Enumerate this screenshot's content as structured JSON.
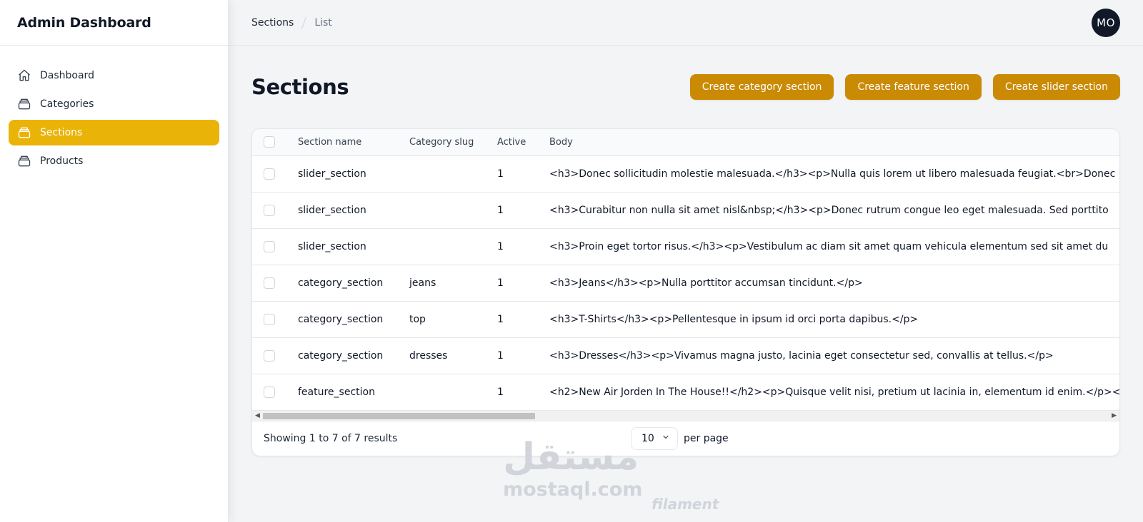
{
  "app": {
    "title": "Admin Dashboard"
  },
  "sidebar": {
    "items": [
      {
        "label": "Dashboard",
        "icon": "home-icon",
        "active": false
      },
      {
        "label": "Categories",
        "icon": "archive-icon",
        "active": false
      },
      {
        "label": "Sections",
        "icon": "archive-icon",
        "active": true
      },
      {
        "label": "Products",
        "icon": "archive-icon",
        "active": false
      }
    ]
  },
  "topbar": {
    "breadcrumb": [
      "Sections",
      "List"
    ],
    "avatar_initials": "MO"
  },
  "page": {
    "title": "Sections",
    "actions": [
      "Create category section",
      "Create feature section",
      "Create slider section"
    ]
  },
  "table": {
    "columns": [
      "Section name",
      "Category slug",
      "Active",
      "Body"
    ],
    "rows": [
      {
        "name": "slider_section",
        "slug": "",
        "active": "1",
        "body": "<h3>Donec sollicitudin molestie malesuada.</h3><p>Nulla quis lorem ut libero malesuada feugiat.<br>Donec"
      },
      {
        "name": "slider_section",
        "slug": "",
        "active": "1",
        "body": "<h3>Curabitur non nulla sit amet nisl&nbsp;</h3><p>Donec rutrum congue leo eget malesuada. Sed porttito"
      },
      {
        "name": "slider_section",
        "slug": "",
        "active": "1",
        "body": "<h3>Proin eget tortor risus.</h3><p>Vestibulum ac diam sit amet quam vehicula elementum sed sit amet du"
      },
      {
        "name": "category_section",
        "slug": "jeans",
        "active": "1",
        "body": "<h3>Jeans</h3><p>Nulla porttitor accumsan tincidunt.</p>"
      },
      {
        "name": "category_section",
        "slug": "top",
        "active": "1",
        "body": "<h3>T-Shirts</h3><p>Pellentesque in ipsum id orci porta dapibus.</p>"
      },
      {
        "name": "category_section",
        "slug": "dresses",
        "active": "1",
        "body": "<h3>Dresses</h3><p>Vivamus magna justo, lacinia eget consectetur sed, convallis at tellus.</p>"
      },
      {
        "name": "feature_section",
        "slug": "",
        "active": "1",
        "body": "<h2>New Air Jorden In The House!!</h2><p>Quisque velit nisi, pretium ut lacinia in, elementum id enim.</p><"
      }
    ]
  },
  "footer": {
    "summary": "Showing 1 to 7 of 7 results",
    "per_page_value": "10",
    "per_page_label": "per page"
  },
  "watermark": {
    "arabic": "مستقل",
    "site": "mostaql.com",
    "brand": "filament"
  },
  "colors": {
    "accent": "#eab308",
    "button": "#ca8a04",
    "avatar": "#111827"
  }
}
